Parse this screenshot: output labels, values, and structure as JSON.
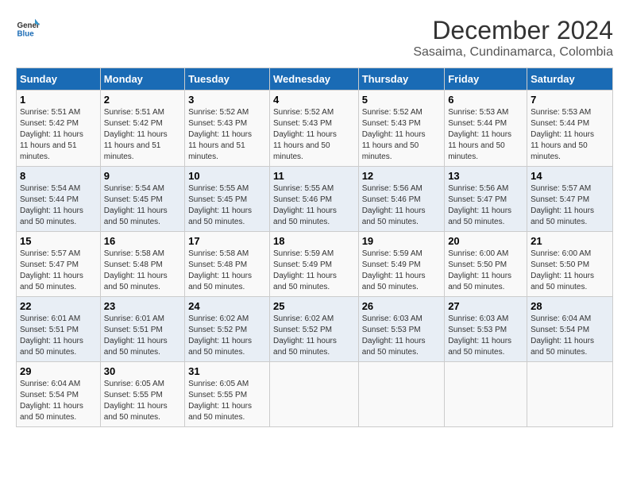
{
  "logo": {
    "line1": "General",
    "line2": "Blue"
  },
  "title": "December 2024",
  "subtitle": "Sasaima, Cundinamarca, Colombia",
  "days_of_week": [
    "Sunday",
    "Monday",
    "Tuesday",
    "Wednesday",
    "Thursday",
    "Friday",
    "Saturday"
  ],
  "weeks": [
    [
      {
        "day": "1",
        "sunrise": "5:51 AM",
        "sunset": "5:42 PM",
        "daylight": "11 hours and 51 minutes."
      },
      {
        "day": "2",
        "sunrise": "5:51 AM",
        "sunset": "5:42 PM",
        "daylight": "11 hours and 51 minutes."
      },
      {
        "day": "3",
        "sunrise": "5:52 AM",
        "sunset": "5:43 PM",
        "daylight": "11 hours and 51 minutes."
      },
      {
        "day": "4",
        "sunrise": "5:52 AM",
        "sunset": "5:43 PM",
        "daylight": "11 hours and 50 minutes."
      },
      {
        "day": "5",
        "sunrise": "5:52 AM",
        "sunset": "5:43 PM",
        "daylight": "11 hours and 50 minutes."
      },
      {
        "day": "6",
        "sunrise": "5:53 AM",
        "sunset": "5:44 PM",
        "daylight": "11 hours and 50 minutes."
      },
      {
        "day": "7",
        "sunrise": "5:53 AM",
        "sunset": "5:44 PM",
        "daylight": "11 hours and 50 minutes."
      }
    ],
    [
      {
        "day": "8",
        "sunrise": "5:54 AM",
        "sunset": "5:44 PM",
        "daylight": "11 hours and 50 minutes."
      },
      {
        "day": "9",
        "sunrise": "5:54 AM",
        "sunset": "5:45 PM",
        "daylight": "11 hours and 50 minutes."
      },
      {
        "day": "10",
        "sunrise": "5:55 AM",
        "sunset": "5:45 PM",
        "daylight": "11 hours and 50 minutes."
      },
      {
        "day": "11",
        "sunrise": "5:55 AM",
        "sunset": "5:46 PM",
        "daylight": "11 hours and 50 minutes."
      },
      {
        "day": "12",
        "sunrise": "5:56 AM",
        "sunset": "5:46 PM",
        "daylight": "11 hours and 50 minutes."
      },
      {
        "day": "13",
        "sunrise": "5:56 AM",
        "sunset": "5:47 PM",
        "daylight": "11 hours and 50 minutes."
      },
      {
        "day": "14",
        "sunrise": "5:57 AM",
        "sunset": "5:47 PM",
        "daylight": "11 hours and 50 minutes."
      }
    ],
    [
      {
        "day": "15",
        "sunrise": "5:57 AM",
        "sunset": "5:47 PM",
        "daylight": "11 hours and 50 minutes."
      },
      {
        "day": "16",
        "sunrise": "5:58 AM",
        "sunset": "5:48 PM",
        "daylight": "11 hours and 50 minutes."
      },
      {
        "day": "17",
        "sunrise": "5:58 AM",
        "sunset": "5:48 PM",
        "daylight": "11 hours and 50 minutes."
      },
      {
        "day": "18",
        "sunrise": "5:59 AM",
        "sunset": "5:49 PM",
        "daylight": "11 hours and 50 minutes."
      },
      {
        "day": "19",
        "sunrise": "5:59 AM",
        "sunset": "5:49 PM",
        "daylight": "11 hours and 50 minutes."
      },
      {
        "day": "20",
        "sunrise": "6:00 AM",
        "sunset": "5:50 PM",
        "daylight": "11 hours and 50 minutes."
      },
      {
        "day": "21",
        "sunrise": "6:00 AM",
        "sunset": "5:50 PM",
        "daylight": "11 hours and 50 minutes."
      }
    ],
    [
      {
        "day": "22",
        "sunrise": "6:01 AM",
        "sunset": "5:51 PM",
        "daylight": "11 hours and 50 minutes."
      },
      {
        "day": "23",
        "sunrise": "6:01 AM",
        "sunset": "5:51 PM",
        "daylight": "11 hours and 50 minutes."
      },
      {
        "day": "24",
        "sunrise": "6:02 AM",
        "sunset": "5:52 PM",
        "daylight": "11 hours and 50 minutes."
      },
      {
        "day": "25",
        "sunrise": "6:02 AM",
        "sunset": "5:52 PM",
        "daylight": "11 hours and 50 minutes."
      },
      {
        "day": "26",
        "sunrise": "6:03 AM",
        "sunset": "5:53 PM",
        "daylight": "11 hours and 50 minutes."
      },
      {
        "day": "27",
        "sunrise": "6:03 AM",
        "sunset": "5:53 PM",
        "daylight": "11 hours and 50 minutes."
      },
      {
        "day": "28",
        "sunrise": "6:04 AM",
        "sunset": "5:54 PM",
        "daylight": "11 hours and 50 minutes."
      }
    ],
    [
      {
        "day": "29",
        "sunrise": "6:04 AM",
        "sunset": "5:54 PM",
        "daylight": "11 hours and 50 minutes."
      },
      {
        "day": "30",
        "sunrise": "6:05 AM",
        "sunset": "5:55 PM",
        "daylight": "11 hours and 50 minutes."
      },
      {
        "day": "31",
        "sunrise": "6:05 AM",
        "sunset": "5:55 PM",
        "daylight": "11 hours and 50 minutes."
      },
      null,
      null,
      null,
      null
    ]
  ],
  "labels": {
    "sunrise": "Sunrise:",
    "sunset": "Sunset:",
    "daylight": "Daylight:"
  }
}
